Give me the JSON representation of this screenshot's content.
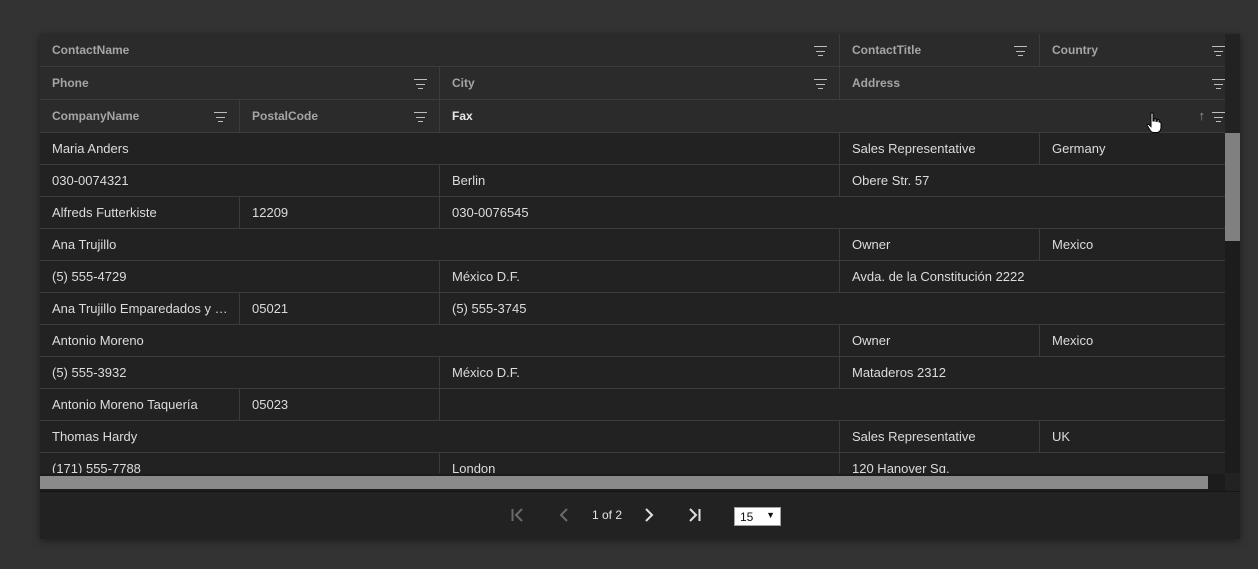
{
  "headers": {
    "row1": [
      {
        "label": "ContactName"
      },
      {
        "label": "ContactTitle"
      },
      {
        "label": "Country"
      }
    ],
    "row2": [
      {
        "label": "Phone"
      },
      {
        "label": "City"
      },
      {
        "label": "Address"
      }
    ],
    "row3": [
      {
        "label": "CompanyName"
      },
      {
        "label": "PostalCode"
      },
      {
        "label": "Fax",
        "sorted": "ascending"
      }
    ]
  },
  "records": [
    {
      "ContactName": "Maria Anders",
      "ContactTitle": "Sales Representative",
      "Country": "Germany",
      "Phone": "030-0074321",
      "City": "Berlin",
      "Address": "Obere Str. 57",
      "CompanyName": "Alfreds Futterkiste",
      "PostalCode": "12209",
      "Fax": "030-0076545"
    },
    {
      "ContactName": "Ana Trujillo",
      "ContactTitle": "Owner",
      "Country": "Mexico",
      "Phone": "(5) 555-4729",
      "City": "México D.F.",
      "Address": "Avda. de la Constitución 2222",
      "CompanyName": "Ana Trujillo Emparedados y he...",
      "PostalCode": "05021",
      "Fax": "(5) 555-3745"
    },
    {
      "ContactName": "Antonio Moreno",
      "ContactTitle": "Owner",
      "Country": "Mexico",
      "Phone": "(5) 555-3932",
      "City": "México D.F.",
      "Address": "Mataderos 2312",
      "CompanyName": "Antonio Moreno Taquería",
      "PostalCode": "05023",
      "Fax": ""
    },
    {
      "ContactName": "Thomas Hardy",
      "ContactTitle": "Sales Representative",
      "Country": "UK",
      "Phone": "(171) 555-7788",
      "City": "London",
      "Address": "120 Hanover Sq.",
      "CompanyName": "",
      "PostalCode": "",
      "Fax": ""
    }
  ],
  "pager": {
    "first_icon": "first-page-icon",
    "prev_icon": "previous-page-icon",
    "page_info": "1 of 2",
    "next_icon": "next-page-icon",
    "last_icon": "last-page-icon",
    "page_size": "15"
  },
  "colors": {
    "page_background": "#333333",
    "grid_background": "#222222",
    "header_background": "#2b2b2b",
    "border": "#3c3c3c",
    "scroll_thumb": "#808080"
  }
}
